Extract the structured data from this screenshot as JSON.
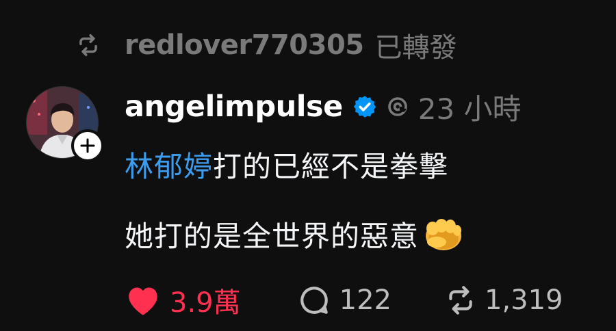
{
  "repost": {
    "username": "redlover770305",
    "suffix": "已轉發",
    "icon": "repost-icon"
  },
  "post": {
    "author": "angelimpulse",
    "verified": true,
    "time": "23 小時",
    "line1_mention": "林郁婷",
    "line1_rest": "打的已經不是拳擊",
    "line2": "她打的是全世界的惡意",
    "emoji": "fist-emoji"
  },
  "actions": {
    "likes": "3.9萬",
    "replies": "122",
    "reposts": "1,319"
  },
  "colors": {
    "background": "#0f0f10",
    "mention": "#3b9cf0",
    "like": "#ff3050",
    "muted": "#7a7a7a",
    "verified": "#0095f6"
  }
}
